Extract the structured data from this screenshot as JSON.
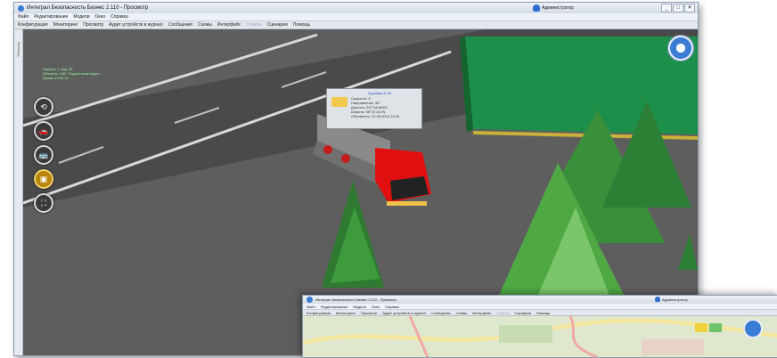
{
  "window": {
    "title": "Интеграл Безопасность Бизнес 2.110 - Просмотр",
    "user": "Администратор",
    "controls": [
      "_",
      "□",
      "✕"
    ]
  },
  "menu": [
    "Файл",
    "Редактирование",
    "Модели",
    "Окно",
    "Справка"
  ],
  "toolbar": [
    "Конфигурация",
    "Мониторинг",
    "Просмотр",
    "Аудит устройств и журнал",
    "Сообщения",
    "Схемы",
    "Интерфейс",
    "Отчёты",
    "Сценарии",
    "Помощь"
  ],
  "toolbar_disabled_index": 7,
  "side_tab": "Объекты",
  "status_lines": [
    "Камера: 2, вид 3D",
    "Объекты: 148 / Подсистема видео",
    "Время 13:05:12"
  ],
  "nav_buttons": [
    {
      "name": "rotate-icon",
      "glyph": "⟲"
    },
    {
      "name": "car-icon",
      "glyph": "🚗"
    },
    {
      "name": "bus-icon",
      "glyph": "🚌"
    },
    {
      "name": "building-icon",
      "glyph": "▣"
    },
    {
      "name": "fullscreen-icon",
      "glyph": "⛶"
    }
  ],
  "tooltip": {
    "title": "Грузовик А-18",
    "lines": [
      "Скорость: 0",
      "Направление: 80°",
      "Долгота: 037°48.805'E",
      "Широта: 56°10.414'N",
      "Обновлено: 12.05.2014 18:42"
    ]
  },
  "window2": {
    "title": "Интеграл Безопасность Бизнес 2.110 - Просмотр",
    "user": "Администратор",
    "menu": [
      "Файл",
      "Редактирование",
      "Модели",
      "Окно",
      "Справка"
    ],
    "toolbar": [
      "Конфигурация",
      "Мониторинг",
      "Просмотр",
      "Аудит устройств и журнал",
      "Сообщения",
      "Схемы",
      "Интерфейс",
      "Отчёты",
      "Сценарии",
      "Помощь"
    ]
  },
  "colors": {
    "accent": "#2f6fd0",
    "truck_cab": "#e01010",
    "roof": "#1d8f4a",
    "grass": "#3f8f35"
  }
}
